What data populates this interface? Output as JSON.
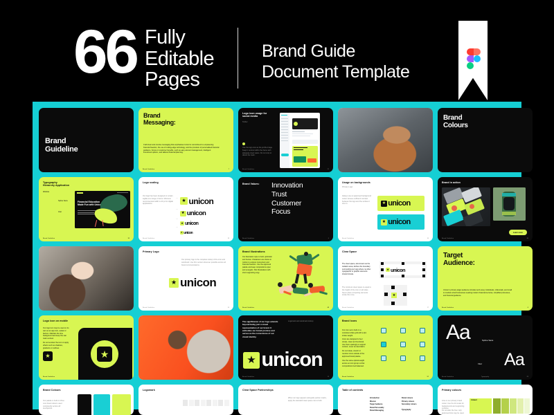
{
  "header": {
    "number": "66",
    "line_a": "Fully",
    "line_b": "Editable",
    "line_c": "Pages",
    "title_line1": "Brand Guide",
    "title_line2": "Document Template",
    "logo": "figma-logo"
  },
  "colors": {
    "background": "#000000",
    "board": "#15CFD4",
    "lime": "#D8F652",
    "teal": "#19CFD4",
    "dark": "#0B0B0B",
    "white": "#FFFFFF"
  },
  "brand": {
    "wordmark": "unicon",
    "footer": "Brand Guideline"
  },
  "slides": {
    "s1": {
      "title_l1": "Brand",
      "title_l2": "Guideline"
    },
    "s2": {
      "title_l1": "Brand",
      "title_l2": "Messaging:",
      "body": "Craft clear and concise messaging that emphasises Unicon's commitment to empowering financial freedom, the use of cutting-edge technology, and the provision of personalised financial guidance. Focus on customer benefits, such as easy account management, intelligent investment options, and tailored financial planning.",
      "page": "7"
    },
    "s3": {
      "title": "Logo icon usage for social media",
      "sub": "Twitter",
      "body": "Use the logo icon as the profile image. Keep it centred within the frame with adequate clear space. Do not crop or distort the mark.",
      "page": "21"
    },
    "s4": {
      "title": "photo-woman-phone"
    },
    "s5": {
      "title_l1": "Brand",
      "title_l2": "Colours"
    },
    "s6": {
      "title_l1": "Typography",
      "title_l2": "Hierarchy Application",
      "sub": "Website",
      "mock_l1": "Financial Education",
      "mock_l2": "Made Fun with Unicon",
      "label_a": "Spline Sans",
      "label_b": "Inter",
      "page": "33"
    },
    "s7": {
      "title": "Logo scaling",
      "body": "Our logo has been designed to remain legible at a range of sizes. Minimum recommended width is 24 px for digital applications.",
      "sizes": [
        "unicon",
        "unicon",
        "unicon",
        "unicon"
      ],
      "page": "18"
    },
    "s8": {
      "label": "Brand Values:",
      "v1": "Innovation",
      "v2": "Trust",
      "v3": "Customer",
      "v4": "Focus",
      "page": "5"
    },
    "s9": {
      "title": "Usage on backgrounds",
      "sub": "Primary Logo",
      "body": "Always use an approved background colour. Ensure sufficient contrast between the logo and the surface it sits on.",
      "page": "16"
    },
    "s10": {
      "title": "Brand in action",
      "btn": "Learn more",
      "page": "45"
    },
    "s11": {
      "title": "photo-woman-tablet"
    },
    "s12": {
      "title": "Primary Logo",
      "body": "Our primary logo is the complete lockup of the icon and wordmark. Use this version wherever possible across all brand communications.",
      "page": "14"
    },
    "s13": {
      "title": "Brand Illustrations",
      "body": "Our illustration style is bold, optimistic and human. Characters are shown in motion to express momentum and financial freedom. Use the approved palette and keep compositions open and energetic. Pair illustrations with short supporting copy.",
      "page": "48"
    },
    "s14": {
      "title": "Clear Space",
      "body": "The clear space, also known as the isolation area, defines the boundary surrounding our logo where no other typographic or graphic elements should intrude.",
      "body2": "The minimum clear space is equal to the height of the icon on all sides. Never place competing elements inside this zone.",
      "page": "17"
    },
    "s15": {
      "title_l1": "Target",
      "title_l2": "Audience:",
      "body": "Unicon's primary target audience includes tech-savvy individuals, millennials, and small to medium-sized businesses seeking modern financial services, simplified processes, and financial guidance.",
      "page": "6"
    },
    "s16": {
      "title": "Logo icon on mobile",
      "body": "Our logo icon may be used on its own as an app icon, avatar or favicon. Maintain the lime background and keep the star mark centred.",
      "body2": "Do not recolour the icon or apply effects such as shadows, gradients or outlines.",
      "page": "22"
    },
    "s17": {
      "title": "photo-man-disco-ball"
    },
    "s18": {
      "body": "The significance of our logo extends beyond being just a visual representation of our brand. It embodies our brand promise and serves as the cornerstone of our visual identity.",
      "caption": "Logomark and wordmark lockup",
      "wordmark": "unicon",
      "page": "13"
    },
    "s19": {
      "title": "Brand Icons",
      "body": "Our icon set is built on a consistent 24px grid with a 2px stroke weight.",
      "body2": "Icons are designed to feel simple, clear and functional. Use them sparingly to support content, never as decoration.",
      "body3": "Do not rotate, stretch or recolour icons outside of the approved brand palette.",
      "body4": "Use the same optical weight across an icon group so that compositions feel balanced.",
      "page": "52"
    },
    "s20": {
      "aa_big": "Aa",
      "font_a": "Spline Sans",
      "font_b": "Inter",
      "aa_small": "Aa",
      "foot": "Typography",
      "page": "29"
    },
    "s21": {
      "title": "Brand Colours",
      "body": "Our palette is built on three core brand colours used consistently across all touchpoints.",
      "swatches": [
        "#0B0B0B",
        "#19CFD4",
        "#D8F652"
      ]
    },
    "s22": {
      "title": "Logomark"
    },
    "s23": {
      "title": "Clear Space Partnerships",
      "body": "When our logo appears alongside partner marks, apply the standard clear space rule to both."
    },
    "s24": {
      "title": "Table of contents",
      "col1": [
        "Introduction",
        "Mission",
        "Target Audience",
        "Brand Personality",
        "Brand Messaging"
      ],
      "col2": [
        "Brand colours",
        "Primary colours",
        "Secondary colours",
        "Typography"
      ]
    },
    "s25": {
      "title": "Primary colours",
      "body": "Lime is our primary brand colour. Use the tint scale for backgrounds and supporting surfaces.",
      "body2": "Do not alter the hue; only approved tints may be used.",
      "chip": "PRIMARY"
    }
  }
}
